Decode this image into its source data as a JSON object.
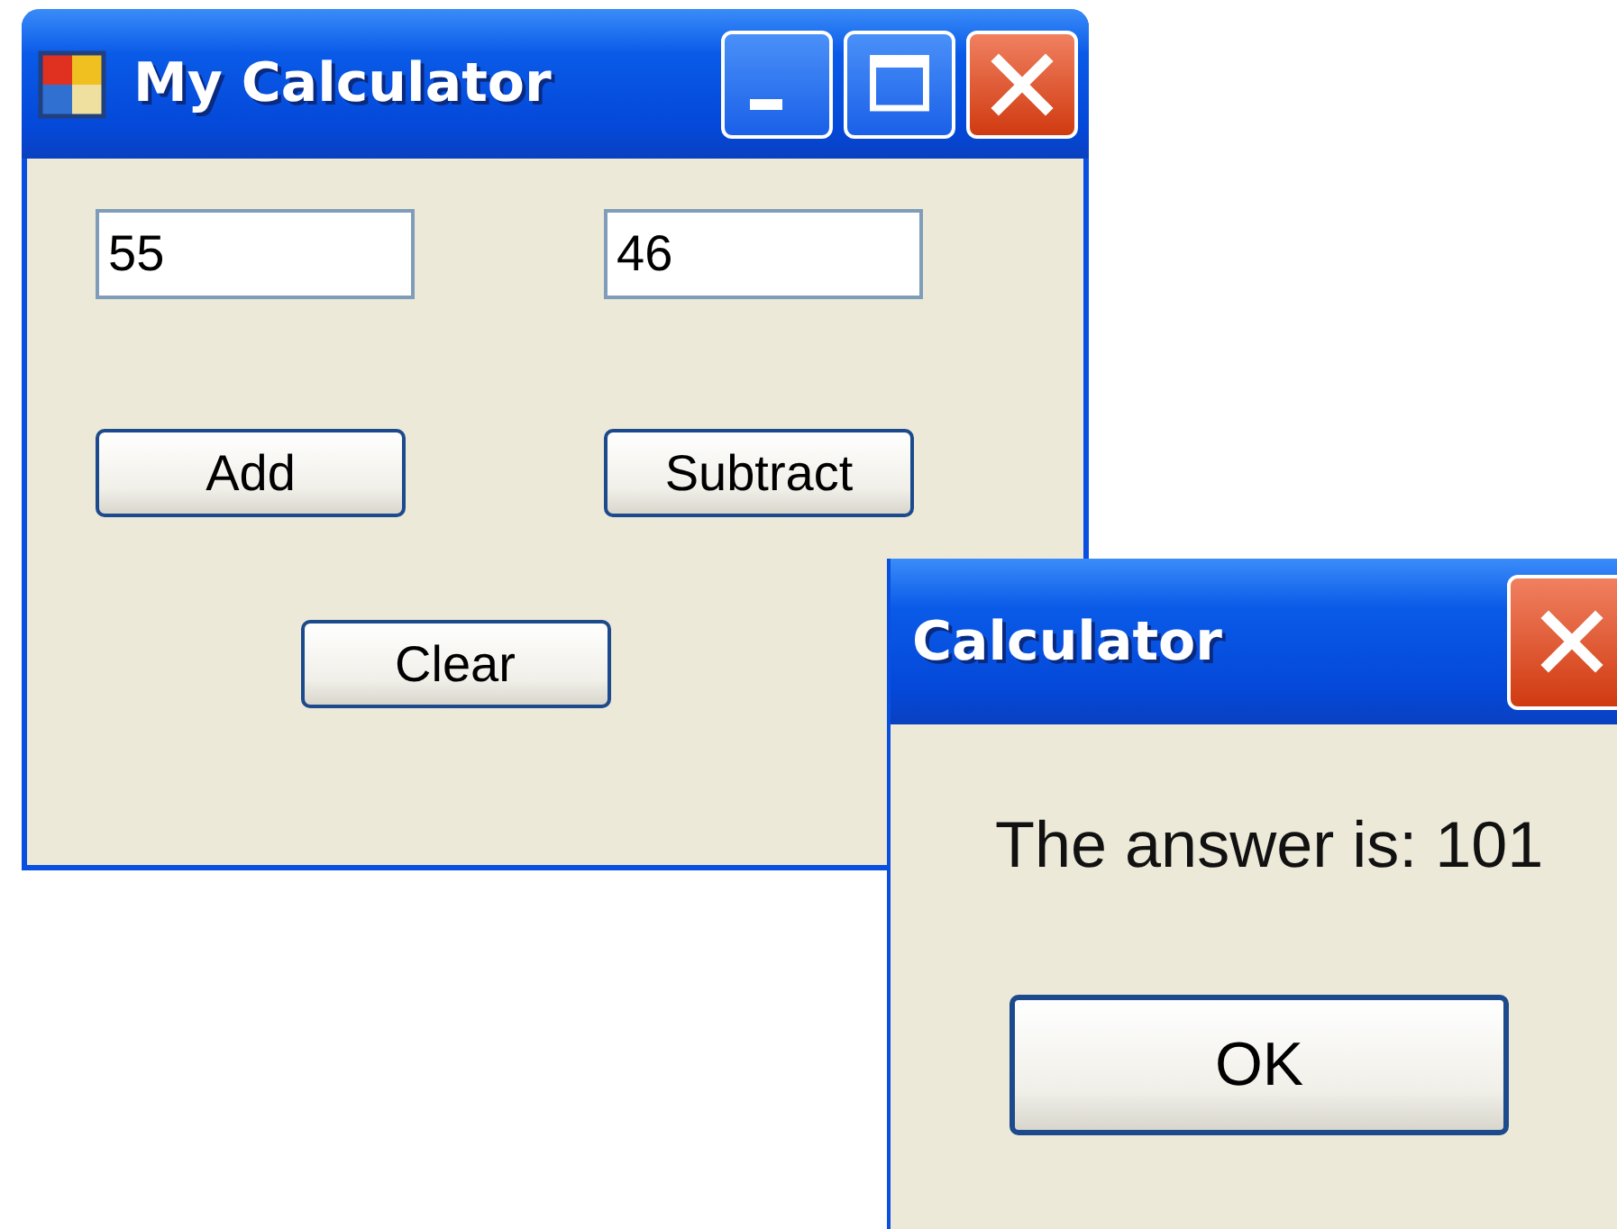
{
  "main_window": {
    "title": "My Calculator",
    "fields": [
      {
        "value": "55"
      },
      {
        "value": "46"
      }
    ],
    "buttons": [
      "Add",
      "Subtract",
      "Clear"
    ]
  },
  "dialog": {
    "title": "Calculator",
    "message": "The answer is: 101",
    "buttons": [
      "OK"
    ]
  }
}
